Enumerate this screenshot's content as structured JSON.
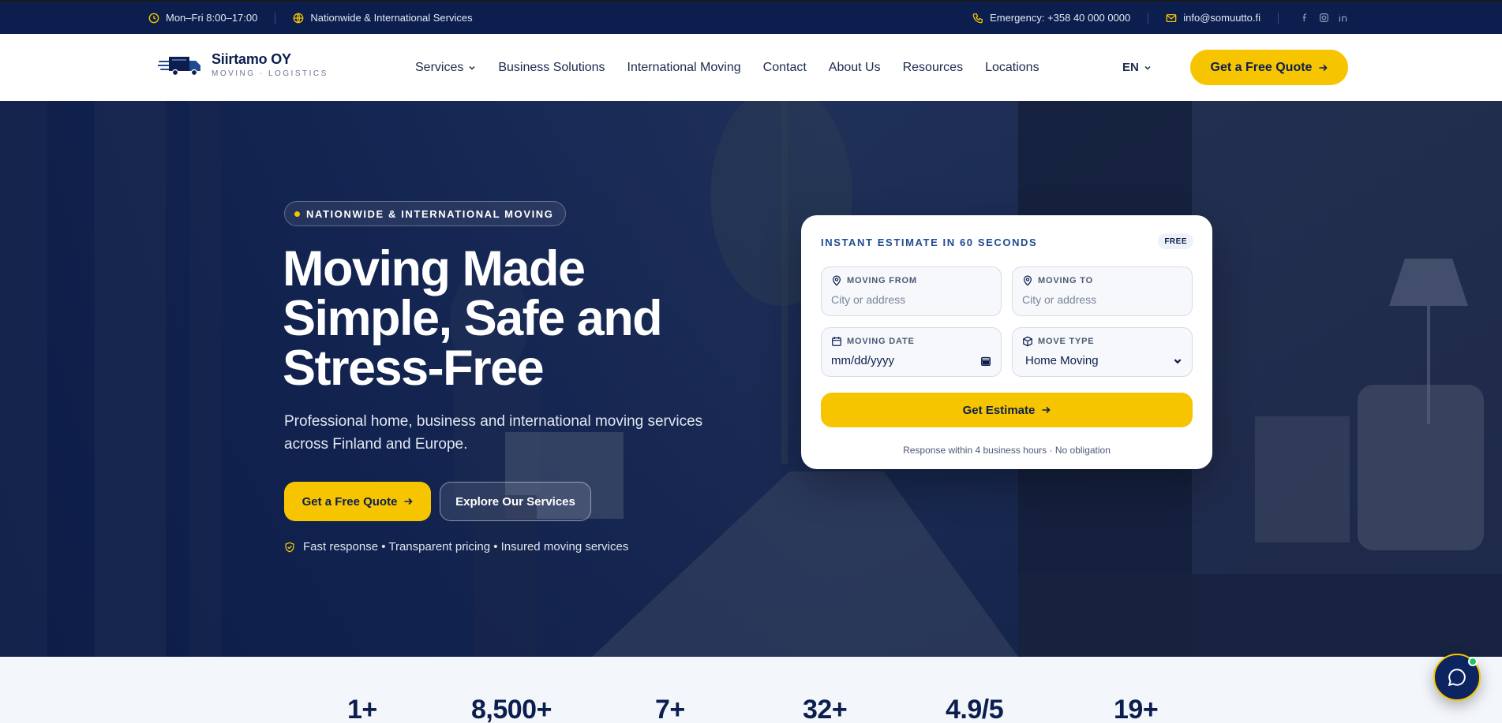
{
  "topbar": {
    "hours": "Mon–Fri 8:00–17:00",
    "coverage": "Nationwide & International Services",
    "emergency": "Emergency: +358 40 000 0000",
    "email": "info@somuutto.fi",
    "socials": [
      "facebook-icon",
      "instagram-icon",
      "linkedin-icon"
    ]
  },
  "header": {
    "brand": "Siirtamo OY",
    "tagline": "MOVING · LOGISTICS",
    "nav": [
      "Services",
      "Business Solutions",
      "International Moving",
      "Contact",
      "About Us",
      "Resources",
      "Locations"
    ],
    "language": "EN",
    "quote_button": "Get a Free Quote"
  },
  "hero": {
    "eyebrow": "NATIONWIDE & INTERNATIONAL MOVING",
    "title": "Moving Made Simple, Safe and Stress-Free",
    "subtitle": "Professional home, business and international moving services across Finland and Europe.",
    "primary_button": "Get a Free Quote",
    "secondary_button": "Explore Our Services",
    "trust_line": "Fast response • Transparent pricing • Insured moving services"
  },
  "estimate": {
    "title": "INSTANT ESTIMATE IN 60 SECONDS",
    "badge": "FREE",
    "from_label": "MOVING FROM",
    "from_placeholder": "City or address",
    "to_label": "MOVING TO",
    "to_placeholder": "City or address",
    "date_label": "MOVING DATE",
    "date_value": "mm/dd/yyyy",
    "type_label": "MOVE TYPE",
    "type_value": "Home Moving",
    "button": "Get Estimate",
    "note": "Response within 4 business hours · No obligation"
  },
  "stats": [
    "1+",
    "8,500+",
    "7+",
    "32+",
    "4.9/5",
    "19+"
  ],
  "colors": {
    "navy": "#0c1e4e",
    "accent": "#f6c500",
    "online": "#1fc46a"
  }
}
